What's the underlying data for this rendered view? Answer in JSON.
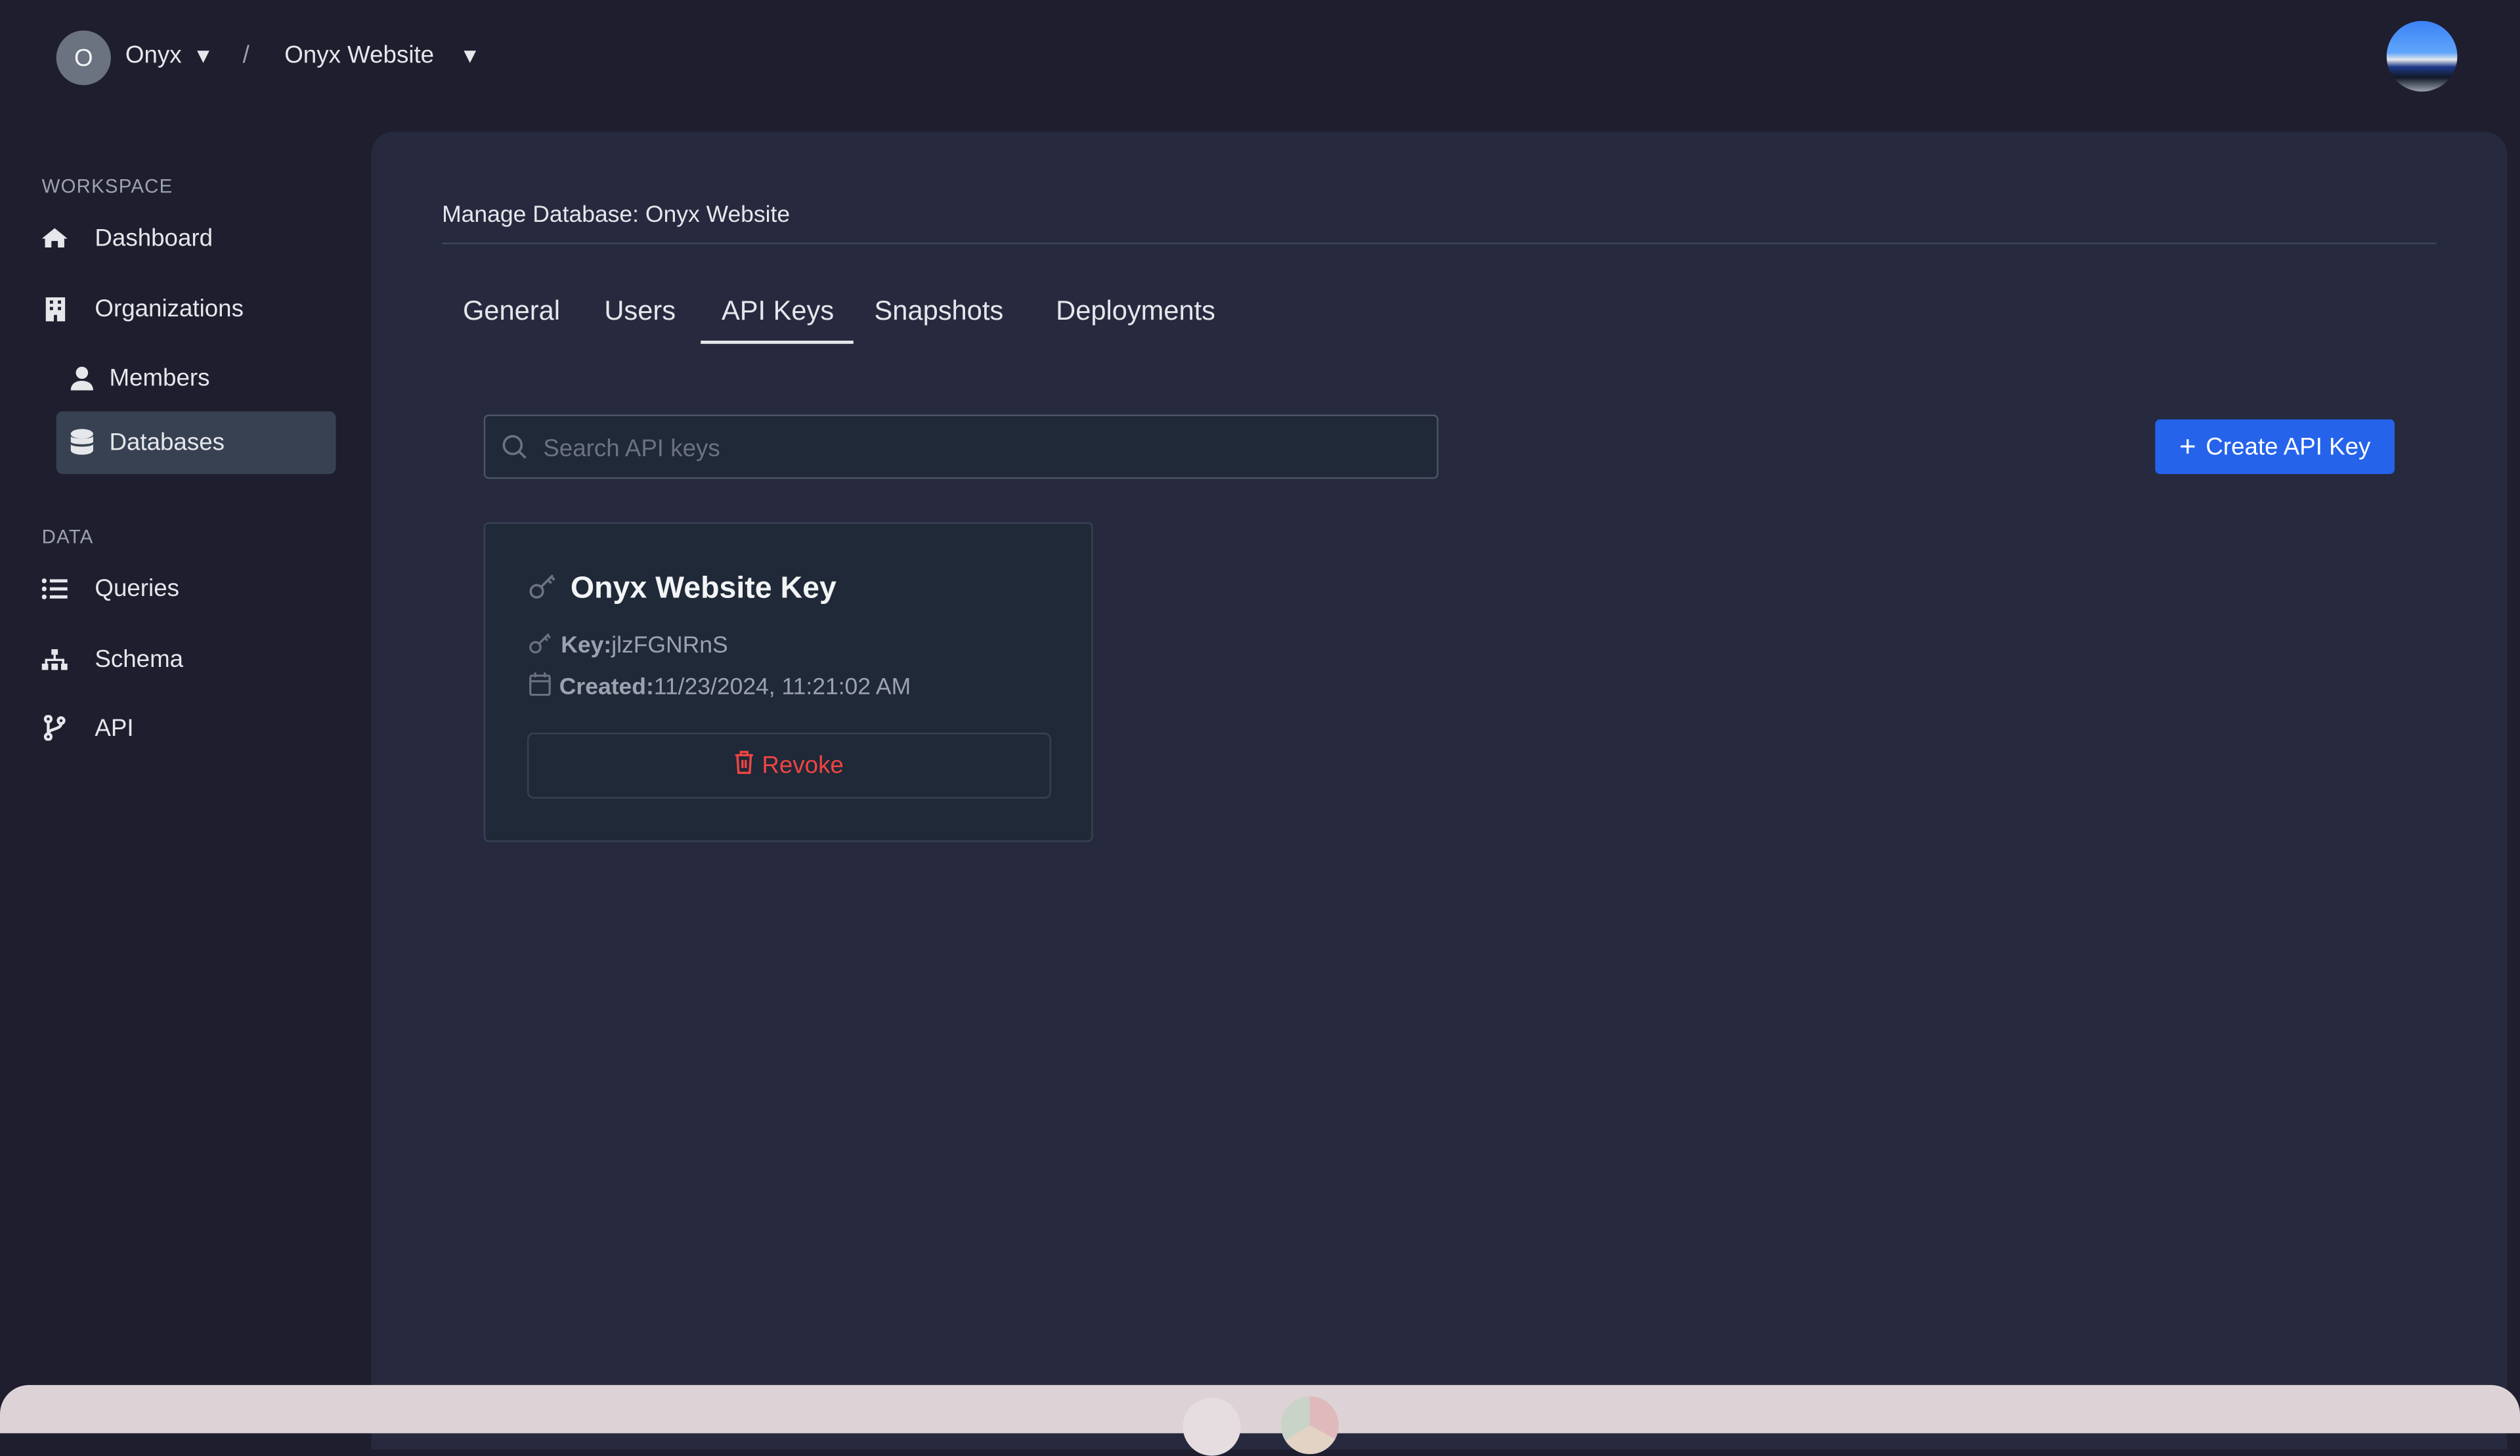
{
  "topbar": {
    "org_initial": "O",
    "org_name": "Onyx",
    "separator": "/",
    "database_name": "Onyx Website",
    "caret": "▼"
  },
  "sidebar": {
    "sections": [
      {
        "title": "WORKSPACE"
      },
      {
        "title": "DATA"
      }
    ],
    "items": [
      {
        "label": "Dashboard",
        "icon": "home-icon"
      },
      {
        "label": "Organizations",
        "icon": "building-icon"
      },
      {
        "label": "Members",
        "icon": "user-icon"
      },
      {
        "label": "Databases",
        "icon": "database-icon",
        "active": true
      },
      {
        "label": "Queries",
        "icon": "list-icon"
      },
      {
        "label": "Schema",
        "icon": "sitemap-icon"
      },
      {
        "label": "API",
        "icon": "code-branch-icon"
      }
    ]
  },
  "main": {
    "title": "Manage Database: Onyx Website",
    "tabs": [
      {
        "label": "General"
      },
      {
        "label": "Users"
      },
      {
        "label": "API Keys",
        "active": true
      },
      {
        "label": "Snapshots"
      },
      {
        "label": "Deployments"
      }
    ],
    "search": {
      "placeholder": "Search API keys",
      "value": ""
    },
    "create_button": "Create API Key",
    "api_keys": [
      {
        "name": "Onyx Website Key",
        "key_label": "Key:",
        "key_value": "jlzFGNRnS",
        "created_label": "Created:",
        "created_value": "11/23/2024, 11:21:02 AM",
        "revoke_label": "Revoke"
      }
    ]
  },
  "colors": {
    "background": "#1e1e2e",
    "panel": "#272a3f",
    "card": "#1f2937",
    "accent": "#2563eb",
    "danger": "#ef4444",
    "active_nav": "#374151"
  }
}
